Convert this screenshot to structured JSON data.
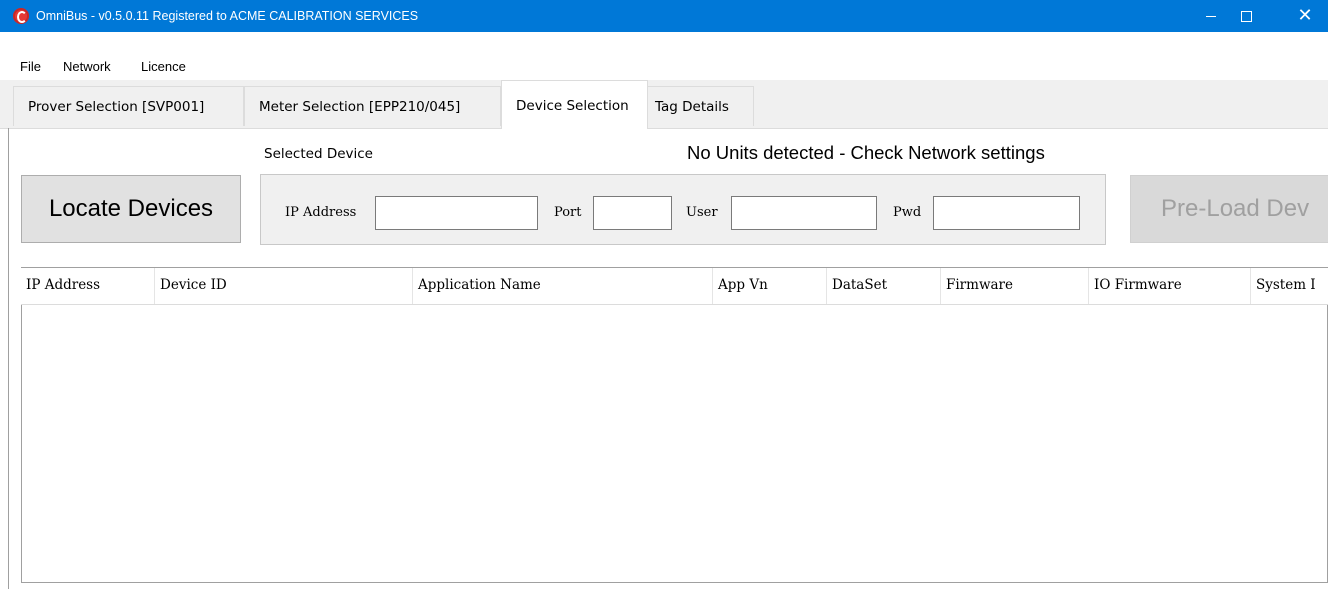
{
  "window": {
    "title": "OmniBus - v0.5.0.11  Registered to ACME CALIBRATION SERVICES",
    "close_glyph": "✕"
  },
  "menu": {
    "items": [
      "File",
      "Network",
      "Licence"
    ]
  },
  "tabs": [
    {
      "label": "Prover Selection [SVP001]",
      "active": false
    },
    {
      "label": "Meter Selection [EPP210/045]",
      "active": false
    },
    {
      "label": "Device Selection",
      "active": true
    },
    {
      "label": "Tag Details",
      "active": false
    }
  ],
  "device_selection": {
    "locate_button": "Locate Devices",
    "selected_device_label": "Selected Device",
    "status": "No Units detected - Check Network settings",
    "preload_button": "Pre-Load Dev",
    "fields": {
      "ip_label": "IP Address",
      "ip_value": "",
      "port_label": "Port",
      "port_value": "",
      "user_label": "User",
      "user_value": "",
      "pwd_label": "Pwd",
      "pwd_value": ""
    },
    "table": {
      "columns": [
        "IP Address",
        "Device ID",
        "Application Name",
        "App Vn",
        "DataSet",
        "Firmware",
        "IO Firmware",
        "System I"
      ],
      "rows": []
    }
  },
  "colors": {
    "titlebar": "#0078d7",
    "tab_background": "#f0f0f0",
    "disabled_text": "#a0a0a0"
  }
}
